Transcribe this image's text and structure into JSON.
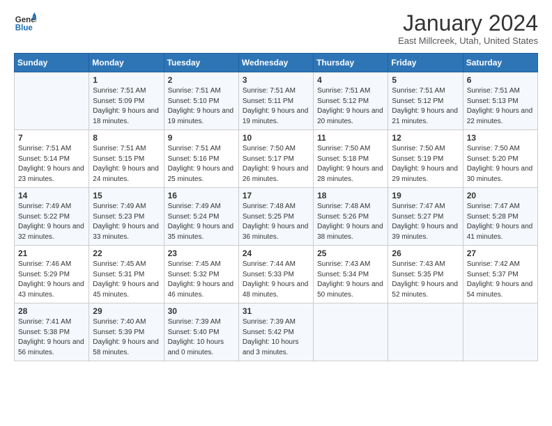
{
  "header": {
    "logo_line1": "General",
    "logo_line2": "Blue",
    "month": "January 2024",
    "location": "East Millcreek, Utah, United States"
  },
  "weekdays": [
    "Sunday",
    "Monday",
    "Tuesday",
    "Wednesday",
    "Thursday",
    "Friday",
    "Saturday"
  ],
  "weeks": [
    [
      {
        "num": "",
        "sunrise": "",
        "sunset": "",
        "daylight": ""
      },
      {
        "num": "1",
        "sunrise": "Sunrise: 7:51 AM",
        "sunset": "Sunset: 5:09 PM",
        "daylight": "Daylight: 9 hours and 18 minutes."
      },
      {
        "num": "2",
        "sunrise": "Sunrise: 7:51 AM",
        "sunset": "Sunset: 5:10 PM",
        "daylight": "Daylight: 9 hours and 19 minutes."
      },
      {
        "num": "3",
        "sunrise": "Sunrise: 7:51 AM",
        "sunset": "Sunset: 5:11 PM",
        "daylight": "Daylight: 9 hours and 19 minutes."
      },
      {
        "num": "4",
        "sunrise": "Sunrise: 7:51 AM",
        "sunset": "Sunset: 5:12 PM",
        "daylight": "Daylight: 9 hours and 20 minutes."
      },
      {
        "num": "5",
        "sunrise": "Sunrise: 7:51 AM",
        "sunset": "Sunset: 5:12 PM",
        "daylight": "Daylight: 9 hours and 21 minutes."
      },
      {
        "num": "6",
        "sunrise": "Sunrise: 7:51 AM",
        "sunset": "Sunset: 5:13 PM",
        "daylight": "Daylight: 9 hours and 22 minutes."
      }
    ],
    [
      {
        "num": "7",
        "sunrise": "Sunrise: 7:51 AM",
        "sunset": "Sunset: 5:14 PM",
        "daylight": "Daylight: 9 hours and 23 minutes."
      },
      {
        "num": "8",
        "sunrise": "Sunrise: 7:51 AM",
        "sunset": "Sunset: 5:15 PM",
        "daylight": "Daylight: 9 hours and 24 minutes."
      },
      {
        "num": "9",
        "sunrise": "Sunrise: 7:51 AM",
        "sunset": "Sunset: 5:16 PM",
        "daylight": "Daylight: 9 hours and 25 minutes."
      },
      {
        "num": "10",
        "sunrise": "Sunrise: 7:50 AM",
        "sunset": "Sunset: 5:17 PM",
        "daylight": "Daylight: 9 hours and 26 minutes."
      },
      {
        "num": "11",
        "sunrise": "Sunrise: 7:50 AM",
        "sunset": "Sunset: 5:18 PM",
        "daylight": "Daylight: 9 hours and 28 minutes."
      },
      {
        "num": "12",
        "sunrise": "Sunrise: 7:50 AM",
        "sunset": "Sunset: 5:19 PM",
        "daylight": "Daylight: 9 hours and 29 minutes."
      },
      {
        "num": "13",
        "sunrise": "Sunrise: 7:50 AM",
        "sunset": "Sunset: 5:20 PM",
        "daylight": "Daylight: 9 hours and 30 minutes."
      }
    ],
    [
      {
        "num": "14",
        "sunrise": "Sunrise: 7:49 AM",
        "sunset": "Sunset: 5:22 PM",
        "daylight": "Daylight: 9 hours and 32 minutes."
      },
      {
        "num": "15",
        "sunrise": "Sunrise: 7:49 AM",
        "sunset": "Sunset: 5:23 PM",
        "daylight": "Daylight: 9 hours and 33 minutes."
      },
      {
        "num": "16",
        "sunrise": "Sunrise: 7:49 AM",
        "sunset": "Sunset: 5:24 PM",
        "daylight": "Daylight: 9 hours and 35 minutes."
      },
      {
        "num": "17",
        "sunrise": "Sunrise: 7:48 AM",
        "sunset": "Sunset: 5:25 PM",
        "daylight": "Daylight: 9 hours and 36 minutes."
      },
      {
        "num": "18",
        "sunrise": "Sunrise: 7:48 AM",
        "sunset": "Sunset: 5:26 PM",
        "daylight": "Daylight: 9 hours and 38 minutes."
      },
      {
        "num": "19",
        "sunrise": "Sunrise: 7:47 AM",
        "sunset": "Sunset: 5:27 PM",
        "daylight": "Daylight: 9 hours and 39 minutes."
      },
      {
        "num": "20",
        "sunrise": "Sunrise: 7:47 AM",
        "sunset": "Sunset: 5:28 PM",
        "daylight": "Daylight: 9 hours and 41 minutes."
      }
    ],
    [
      {
        "num": "21",
        "sunrise": "Sunrise: 7:46 AM",
        "sunset": "Sunset: 5:29 PM",
        "daylight": "Daylight: 9 hours and 43 minutes."
      },
      {
        "num": "22",
        "sunrise": "Sunrise: 7:45 AM",
        "sunset": "Sunset: 5:31 PM",
        "daylight": "Daylight: 9 hours and 45 minutes."
      },
      {
        "num": "23",
        "sunrise": "Sunrise: 7:45 AM",
        "sunset": "Sunset: 5:32 PM",
        "daylight": "Daylight: 9 hours and 46 minutes."
      },
      {
        "num": "24",
        "sunrise": "Sunrise: 7:44 AM",
        "sunset": "Sunset: 5:33 PM",
        "daylight": "Daylight: 9 hours and 48 minutes."
      },
      {
        "num": "25",
        "sunrise": "Sunrise: 7:43 AM",
        "sunset": "Sunset: 5:34 PM",
        "daylight": "Daylight: 9 hours and 50 minutes."
      },
      {
        "num": "26",
        "sunrise": "Sunrise: 7:43 AM",
        "sunset": "Sunset: 5:35 PM",
        "daylight": "Daylight: 9 hours and 52 minutes."
      },
      {
        "num": "27",
        "sunrise": "Sunrise: 7:42 AM",
        "sunset": "Sunset: 5:37 PM",
        "daylight": "Daylight: 9 hours and 54 minutes."
      }
    ],
    [
      {
        "num": "28",
        "sunrise": "Sunrise: 7:41 AM",
        "sunset": "Sunset: 5:38 PM",
        "daylight": "Daylight: 9 hours and 56 minutes."
      },
      {
        "num": "29",
        "sunrise": "Sunrise: 7:40 AM",
        "sunset": "Sunset: 5:39 PM",
        "daylight": "Daylight: 9 hours and 58 minutes."
      },
      {
        "num": "30",
        "sunrise": "Sunrise: 7:39 AM",
        "sunset": "Sunset: 5:40 PM",
        "daylight": "Daylight: 10 hours and 0 minutes."
      },
      {
        "num": "31",
        "sunrise": "Sunrise: 7:39 AM",
        "sunset": "Sunset: 5:42 PM",
        "daylight": "Daylight: 10 hours and 3 minutes."
      },
      {
        "num": "",
        "sunrise": "",
        "sunset": "",
        "daylight": ""
      },
      {
        "num": "",
        "sunrise": "",
        "sunset": "",
        "daylight": ""
      },
      {
        "num": "",
        "sunrise": "",
        "sunset": "",
        "daylight": ""
      }
    ]
  ]
}
